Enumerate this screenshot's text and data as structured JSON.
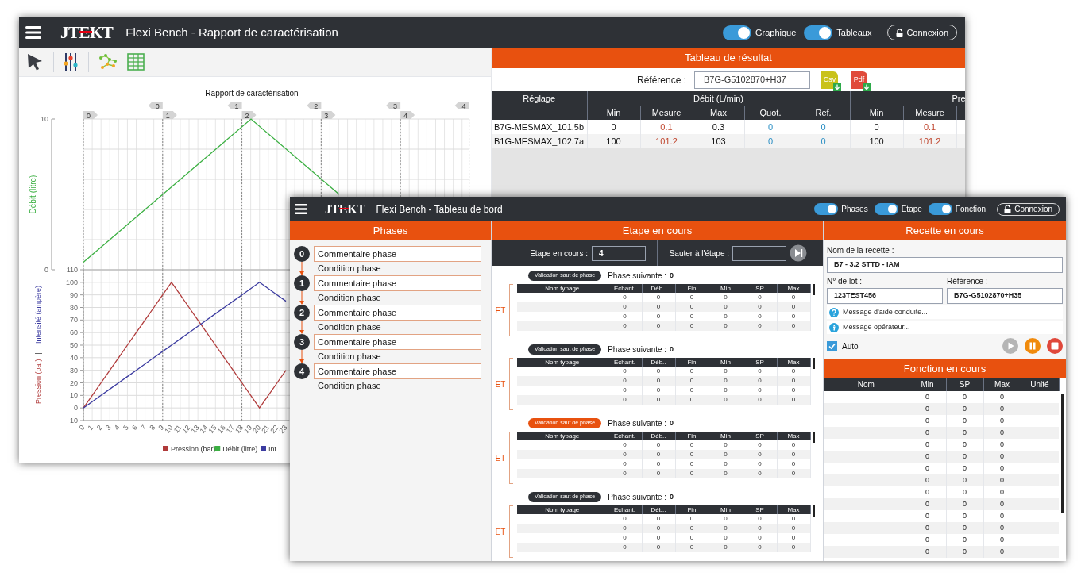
{
  "report": {
    "title_bar": {
      "logo": "JTEKT",
      "title": "Flexi Bench - Rapport de caractérisation",
      "toggles": [
        {
          "label": "Graphique",
          "on": true
        },
        {
          "label": "Tableaux",
          "on": true
        }
      ],
      "login_button": "Connexion"
    },
    "graph": {
      "phase_ends": [
        "0",
        "1",
        "2",
        "3",
        "4"
      ],
      "phase_starts": [
        "0",
        "1",
        "2",
        "3",
        "4"
      ],
      "flow_panel": {
        "title": "Rapport de caractérisation",
        "ylabel": "Débit (litre)",
        "y_tick_labels": [
          "10",
          "0"
        ],
        "legend": {
          "label": "Débit (litre)",
          "color": "#3cb043"
        }
      },
      "pressure_panel": {
        "y_axis_label": [
          {
            "text": "Pression (bar)",
            "color": "#b03a3a"
          },
          {
            "text": "|"
          },
          {
            "text": "Intensité (ampère)",
            "color": "#3b3ba0"
          }
        ],
        "chart_data": {
          "type": "line",
          "grid": true,
          "x": [
            0,
            1,
            2,
            3,
            4,
            5,
            6,
            7,
            8,
            9,
            10,
            11,
            12,
            13,
            14,
            15,
            16,
            17,
            18,
            19,
            20,
            21,
            22,
            23
          ],
          "series": [
            {
              "name": "Pression (bar)",
              "color": "#b03a3a",
              "values": [
                0,
                10,
                20,
                30,
                40,
                50,
                60,
                70,
                80,
                90,
                100,
                90,
                80,
                70,
                60,
                50,
                40,
                30,
                20,
                10,
                0,
                10,
                20,
                30
              ]
            },
            {
              "name": "Int",
              "color": "#3b3ba0",
              "values": [
                0,
                5,
                10,
                15,
                20,
                25,
                30,
                35,
                40,
                45,
                50,
                55,
                60,
                65,
                70,
                75,
                80,
                85,
                90,
                95,
                100,
                95,
                90,
                85
              ]
            }
          ],
          "xlim": [
            0,
            23
          ],
          "ylim": [
            -10,
            110
          ],
          "xticks": [
            0,
            1,
            2,
            3,
            4,
            5,
            6,
            7,
            8,
            9,
            10,
            11,
            12,
            13,
            14,
            15,
            16,
            17,
            18,
            19,
            20,
            21,
            22,
            23
          ],
          "yticks": [
            -10,
            0,
            10,
            20,
            30,
            40,
            50,
            60,
            70,
            80,
            90,
            100,
            110
          ]
        }
      }
    },
    "results": {
      "header": "Tableau de résultat",
      "reference_label": "Référence :",
      "reference_value": "B7G-G5102870+H37",
      "exports": [
        {
          "kind": "csv",
          "label": "Csv"
        },
        {
          "kind": "pdf",
          "label": "Pdf"
        }
      ],
      "groups": [
        {
          "label": "Réglage"
        },
        {
          "label": "Débit (L/min)"
        },
        {
          "label": "Pre"
        }
      ],
      "columns": [
        {
          "label": "Min",
          "kind": "value"
        },
        {
          "label": "Mesure",
          "kind": "measure"
        },
        {
          "label": "Max",
          "kind": "value"
        },
        {
          "label": "Quot.",
          "kind": "ratio"
        },
        {
          "label": "Ref.",
          "kind": "ratio"
        },
        {
          "label": "Min",
          "kind": "value"
        },
        {
          "label": "Mesure",
          "kind": "measure"
        }
      ],
      "rows": [
        {
          "setting": "B7G-MESMAX_101.5b",
          "cells": [
            "0",
            "0.1",
            "0.3",
            "0",
            "0",
            "0",
            "0.1"
          ]
        },
        {
          "setting": "B1G-MESMAX_102.7a",
          "cells": [
            "100",
            "101.2",
            "103",
            "0",
            "0",
            "100",
            "101.2"
          ]
        }
      ]
    }
  },
  "dashboard": {
    "title_bar": {
      "logo": "JTEKT",
      "title": "Flexi Bench - Tableau de bord",
      "toggles": [
        {
          "label": "Phases",
          "on": true
        },
        {
          "label": "Etape",
          "on": true
        },
        {
          "label": "Fonction",
          "on": true
        }
      ],
      "login_button": "Connexion"
    },
    "phases": {
      "header": "Phases",
      "items": [
        {
          "number": "0",
          "comment": "Commentaire phase",
          "condition": "Condition phase"
        },
        {
          "number": "1",
          "comment": "Commentaire phase",
          "condition": "Condition phase"
        },
        {
          "number": "2",
          "comment": "Commentaire phase",
          "condition": "Condition phase"
        },
        {
          "number": "3",
          "comment": "Commentaire phase",
          "condition": "Condition phase"
        },
        {
          "number": "4",
          "comment": "Commentaire phase",
          "condition": "Condition phase"
        }
      ]
    },
    "step": {
      "header": "Etape en cours",
      "current_label": "Etape en cours :",
      "current_value": "4",
      "jump_label": "Sauter à l'étape :",
      "blocks": [
        {
          "button": "Validation saut de phase",
          "active": false,
          "next_label": "Phase suivante :",
          "next_value": "0",
          "operator": "ET",
          "columns": [
            "Nom typage",
            "Echant.",
            "Déb..",
            "Fin",
            "Min",
            "SP",
            "Max"
          ],
          "rows": [
            {
              "values": [
                "0",
                "0",
                "0",
                "0",
                "0",
                "0"
              ]
            },
            {
              "values": [
                "0",
                "0",
                "0",
                "0",
                "0",
                "0"
              ]
            },
            {
              "values": [
                "0",
                "0",
                "0",
                "0",
                "0",
                "0"
              ]
            },
            {
              "values": [
                "0",
                "0",
                "0",
                "0",
                "0",
                "0"
              ]
            }
          ]
        },
        {
          "button": "Validation saut de phase",
          "active": false,
          "next_label": "Phase suivante :",
          "next_value": "0",
          "operator": "ET",
          "columns": [
            "Nom typage",
            "Echant.",
            "Déb..",
            "Fin",
            "Min",
            "SP",
            "Max"
          ],
          "rows": [
            {
              "values": [
                "0",
                "0",
                "0",
                "0",
                "0",
                "0"
              ]
            },
            {
              "values": [
                "0",
                "0",
                "0",
                "0",
                "0",
                "0"
              ]
            },
            {
              "values": [
                "0",
                "0",
                "0",
                "0",
                "0",
                "0"
              ]
            },
            {
              "values": [
                "0",
                "0",
                "0",
                "0",
                "0",
                "0"
              ]
            }
          ]
        },
        {
          "button": "Validation saut de phase",
          "active": true,
          "next_label": "Phase suivante :",
          "next_value": "0",
          "operator": "ET",
          "columns": [
            "Nom typage",
            "Echant.",
            "Déb..",
            "Fin",
            "Min",
            "SP",
            "Max"
          ],
          "rows": [
            {
              "values": [
                "0",
                "0",
                "0",
                "0",
                "0",
                "0"
              ]
            },
            {
              "values": [
                "0",
                "0",
                "0",
                "0",
                "0",
                "0"
              ]
            },
            {
              "values": [
                "0",
                "0",
                "0",
                "0",
                "0",
                "0"
              ]
            },
            {
              "values": [
                "0",
                "0",
                "0",
                "0",
                "0",
                "0"
              ]
            }
          ]
        },
        {
          "button": "Validation saut de phase",
          "active": false,
          "next_label": "Phase suivante :",
          "next_value": "0",
          "operator": "ET",
          "columns": [
            "Nom typage",
            "Echant.",
            "Déb..",
            "Fin",
            "Min",
            "SP",
            "Max"
          ],
          "rows": [
            {
              "values": [
                "0",
                "0",
                "0",
                "0",
                "0",
                "0"
              ]
            },
            {
              "values": [
                "0",
                "0",
                "0",
                "0",
                "0",
                "0"
              ]
            },
            {
              "values": [
                "0",
                "0",
                "0",
                "0",
                "0",
                "0"
              ]
            },
            {
              "values": [
                "0",
                "0",
                "0",
                "0",
                "0",
                "0"
              ]
            }
          ]
        }
      ]
    },
    "recipe": {
      "header": "Recette en cours",
      "name_label": "Nom de la recette :",
      "name_value": "B7 - 3.2 STTD - IAM",
      "lot_label": "N° de lot :",
      "lot_value": "123TEST456",
      "reference_label": "Référence :",
      "reference_value": "B7G-G5102870+H35",
      "messages": [
        {
          "kind": "help",
          "text": "Message d'aide conduite..."
        },
        {
          "kind": "info",
          "text": "Message opérateur..."
        }
      ],
      "auto": {
        "label": "Auto",
        "checked": true
      },
      "controls": [
        {
          "kind": "play",
          "disabled": true
        },
        {
          "kind": "pause",
          "disabled": false
        },
        {
          "kind": "stop",
          "disabled": false
        }
      ]
    },
    "function": {
      "header": "Fonction en cours",
      "columns": [
        "Nom",
        "Min",
        "SP",
        "Max",
        "Unité"
      ],
      "rows": [
        {
          "min": "0",
          "sp": "0",
          "max": "0"
        },
        {
          "min": "0",
          "sp": "0",
          "max": "0"
        },
        {
          "min": "0",
          "sp": "0",
          "max": "0"
        },
        {
          "min": "0",
          "sp": "0",
          "max": "0"
        },
        {
          "min": "0",
          "sp": "0",
          "max": "0"
        },
        {
          "min": "0",
          "sp": "0",
          "max": "0"
        },
        {
          "min": "0",
          "sp": "0",
          "max": "0"
        },
        {
          "min": "0",
          "sp": "0",
          "max": "0"
        },
        {
          "min": "0",
          "sp": "0",
          "max": "0"
        },
        {
          "min": "0",
          "sp": "0",
          "max": "0"
        },
        {
          "min": "0",
          "sp": "0",
          "max": "0"
        },
        {
          "min": "0",
          "sp": "0",
          "max": "0"
        },
        {
          "min": "0",
          "sp": "0",
          "max": "0"
        },
        {
          "min": "0",
          "sp": "0",
          "max": "0"
        }
      ]
    }
  }
}
